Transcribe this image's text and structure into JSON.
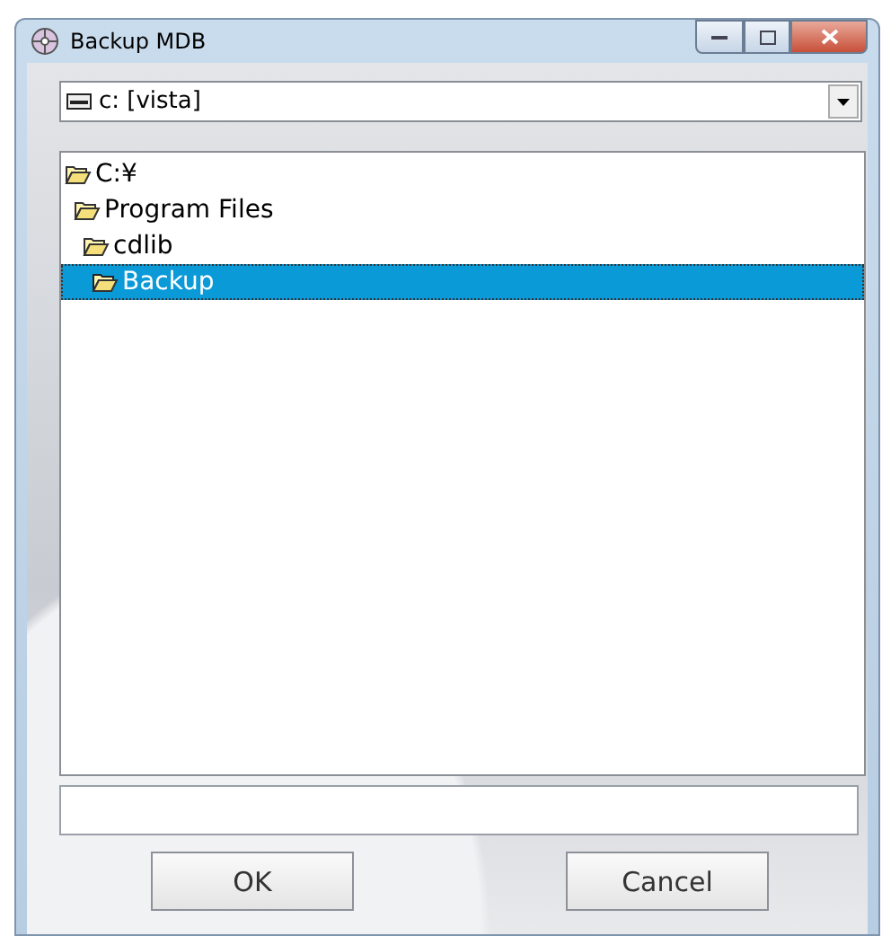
{
  "window": {
    "title": "Backup MDB"
  },
  "drive_select": {
    "value": "c: [vista]"
  },
  "folder_tree": [
    {
      "label": "C:¥",
      "selected": false,
      "children": [
        {
          "label": "Program Files",
          "selected": false,
          "children": [
            {
              "label": "cdlib",
              "selected": false,
              "children": [
                {
                  "label": "Backup",
                  "selected": true
                }
              ]
            }
          ]
        }
      ]
    }
  ],
  "buttons": [
    {
      "label": "OK"
    },
    {
      "label": "Cancel"
    }
  ]
}
